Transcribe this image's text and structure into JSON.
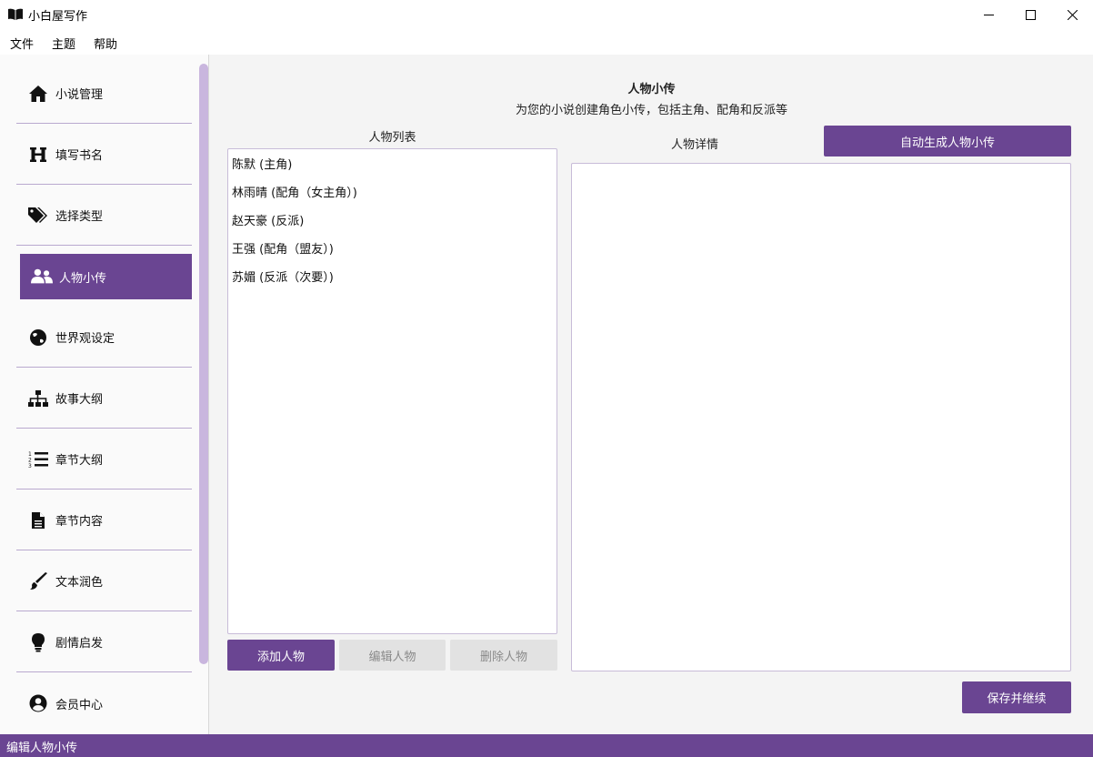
{
  "window": {
    "title": "小白屋写作"
  },
  "menu": {
    "items": [
      "文件",
      "主题",
      "帮助"
    ]
  },
  "sidebar": {
    "items": [
      {
        "label": "小说管理",
        "icon": "home-icon"
      },
      {
        "label": "填写书名",
        "icon": "heading-icon"
      },
      {
        "label": "选择类型",
        "icon": "tags-icon"
      },
      {
        "label": "人物小传",
        "icon": "users-icon",
        "active": true
      },
      {
        "label": "世界观设定",
        "icon": "globe-icon"
      },
      {
        "label": "故事大纲",
        "icon": "sitemap-icon"
      },
      {
        "label": "章节大纲",
        "icon": "list-ol-icon"
      },
      {
        "label": "章节内容",
        "icon": "file-icon"
      },
      {
        "label": "文本润色",
        "icon": "brush-icon"
      },
      {
        "label": "剧情启发",
        "icon": "lightbulb-icon"
      },
      {
        "label": "会员中心",
        "icon": "user-circle-icon"
      }
    ]
  },
  "main": {
    "title": "人物小传",
    "subtitle": "为您的小说创建角色小传，包括主角、配角和反派等",
    "list_label": "人物列表",
    "characters": [
      "陈默 (主角)",
      "林雨晴 (配角（女主角）)",
      "赵天豪 (反派)",
      "王强 (配角（盟友）)",
      "苏媚 (反派（次要）)"
    ],
    "buttons": {
      "add": "添加人物",
      "edit": "编辑人物",
      "delete": "删除人物",
      "auto_generate": "自动生成人物小传",
      "save_continue": "保存并继续"
    },
    "detail_label": "人物详情",
    "detail_text": ""
  },
  "status": {
    "text": "编辑人物小传"
  },
  "colors": {
    "accent": "#6a4592",
    "scrollbar": "#c9b6de"
  }
}
